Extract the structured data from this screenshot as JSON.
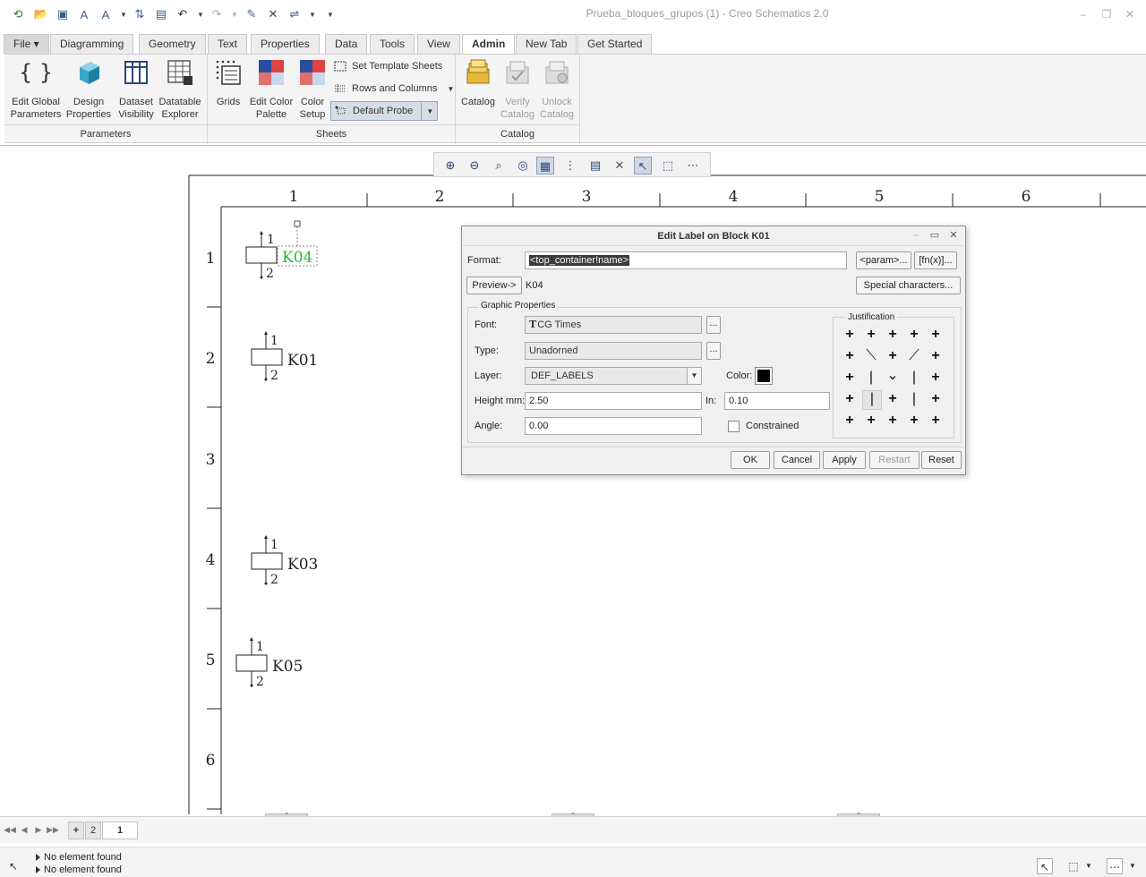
{
  "window": {
    "title": "Prueba_bloques_grupos (1) - Creo Schematics 2.0",
    "controls": [
      "minimize",
      "restore",
      "close"
    ]
  },
  "quick_access": [
    "app-icon",
    "open-icon",
    "new-icon",
    "text-style-icon",
    "font-icon",
    "dropdown-icon",
    "regenerate-icon",
    "save-icon",
    "undo-icon",
    "dropdown-icon",
    "redo-icon",
    "dropdown-icon",
    "edit-icon",
    "close-window-icon",
    "connect-icon",
    "dropdown-icon",
    "customize-icon"
  ],
  "tabs": [
    {
      "label": "File ▾",
      "active": false
    },
    {
      "label": "Diagramming",
      "active": false
    },
    {
      "label": "Geometry",
      "active": false
    },
    {
      "label": "Text",
      "active": false
    },
    {
      "label": "Properties",
      "active": false
    },
    {
      "label": "Data",
      "active": false
    },
    {
      "label": "Tools",
      "active": false
    },
    {
      "label": "View",
      "active": false
    },
    {
      "label": "Admin",
      "active": true
    },
    {
      "label": "New Tab",
      "active": false
    },
    {
      "label": "Get Started",
      "active": false
    }
  ],
  "ribbon": {
    "parameters": {
      "group_label": "Parameters",
      "buttons": [
        {
          "line1": "Edit Global",
          "line2": "Parameters"
        },
        {
          "line1": "Design",
          "line2": "Properties"
        },
        {
          "line1": "Dataset",
          "line2": "Visibility"
        },
        {
          "line1": "Datatable",
          "line2": "Explorer"
        }
      ]
    },
    "sheets": {
      "group_label": "Sheets",
      "buttons": [
        {
          "line1": "Grids",
          "line2": ""
        },
        {
          "line1": "Edit Color",
          "line2": "Palette"
        },
        {
          "line1": "Color",
          "line2": "Setup"
        }
      ],
      "small": [
        {
          "label": "Set Template Sheets"
        },
        {
          "label": "Rows and Columns"
        },
        {
          "label": "Default Probe"
        }
      ]
    },
    "catalog": {
      "group_label": "Catalog",
      "buttons": [
        {
          "line1": "Catalog",
          "line2": "",
          "disabled": false
        },
        {
          "line1": "Verify",
          "line2": "Catalog",
          "disabled": true
        },
        {
          "line1": "Unlock",
          "line2": "Catalog",
          "disabled": true
        }
      ]
    }
  },
  "view_toolbar": [
    "zoom-in-icon",
    "zoom-out-icon",
    "zoom-window-icon",
    "refit-icon",
    "grid-icon",
    "snap-icon",
    "sheet-icon",
    "close-icon",
    "select-icon",
    "select-window-icon",
    "probe-icon"
  ],
  "drawing": {
    "col_labels": [
      "1",
      "2",
      "3",
      "4",
      "5",
      "6"
    ],
    "row_labels": [
      "1",
      "2",
      "3",
      "4",
      "5",
      "6"
    ],
    "blocks": [
      {
        "label": "K04",
        "pin_top": "1",
        "pin_bottom": "2",
        "selected": true
      },
      {
        "label": "K01",
        "pin_top": "1",
        "pin_bottom": "2",
        "selected": false
      },
      {
        "label": "K03",
        "pin_top": "1",
        "pin_bottom": "2",
        "selected": false
      },
      {
        "label": "K05",
        "pin_top": "1",
        "pin_bottom": "2",
        "selected": false
      }
    ],
    "highlight_color": "#2db52d"
  },
  "dialog": {
    "title": "Edit Label on Block K01",
    "format_label": "Format:",
    "format_value": "<top_container!name>",
    "param_button": "<param>...",
    "fn_button": "[fn(x)]...",
    "preview_button": "Preview->",
    "preview_value": "K04",
    "special_button": "Special characters...",
    "graphic_title": "Graphic Properties",
    "font_label": "Font:",
    "font_value": "CG Times",
    "type_label": "Type:",
    "type_value": "Unadorned",
    "layer_label": "Layer:",
    "layer_value": "DEF_LABELS",
    "color_label": "Color:",
    "color_value": "#000000",
    "height_label": "Height mm:",
    "height_value": "2.50",
    "in_label": "In:",
    "in_value": "0.10",
    "angle_label": "Angle:",
    "angle_value": "0.00",
    "constrained_label": "Constrained",
    "constrained_checked": false,
    "justification_title": "Justification",
    "ellipsis": "...",
    "buttons": [
      {
        "label": "OK",
        "disabled": false
      },
      {
        "label": "Cancel",
        "disabled": false
      },
      {
        "label": "Apply",
        "disabled": false
      },
      {
        "label": "Restart",
        "disabled": true
      },
      {
        "label": "Reset",
        "disabled": false
      }
    ]
  },
  "page_tabs": {
    "add": "+",
    "pages": [
      "2",
      "1"
    ],
    "active": "1"
  },
  "status": {
    "messages": [
      "No element found",
      "No element found"
    ]
  }
}
